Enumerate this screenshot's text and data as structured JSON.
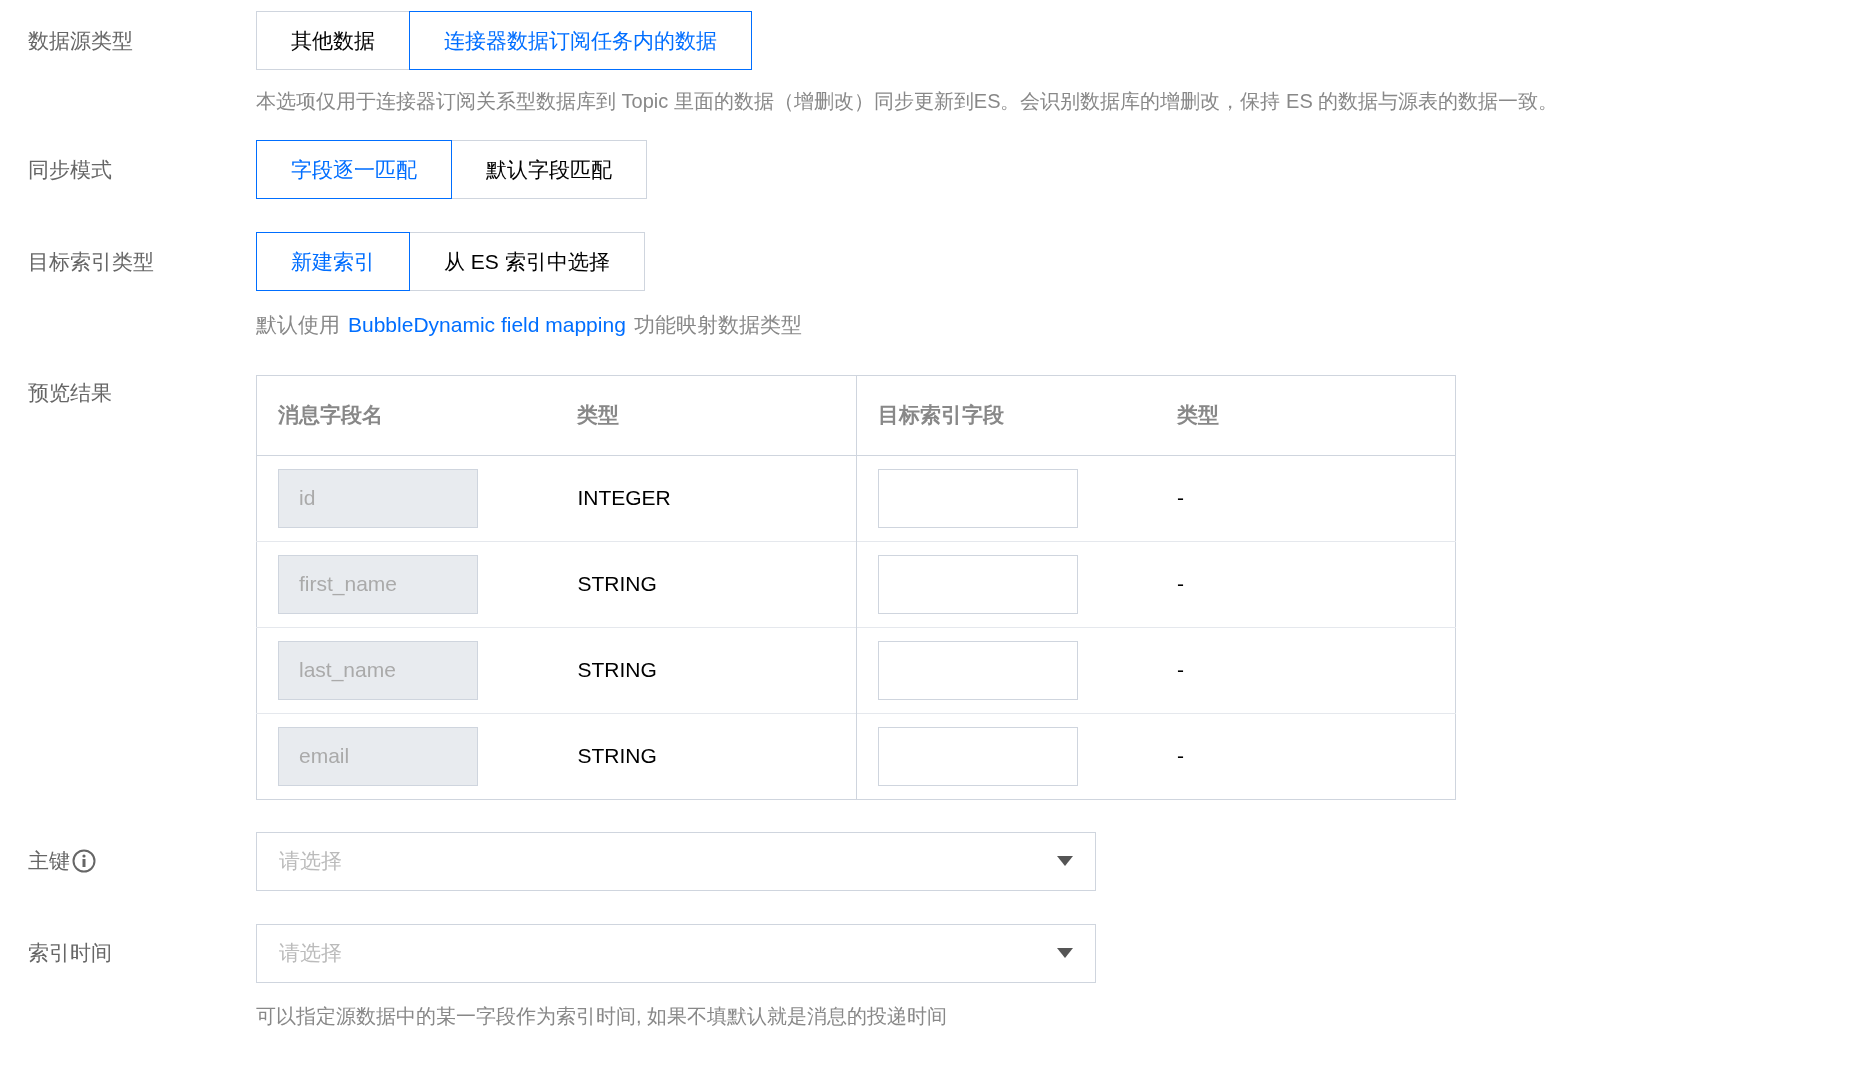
{
  "data_source_type": {
    "label": "数据源类型",
    "options": [
      {
        "label": "其他数据",
        "selected": false
      },
      {
        "label": "连接器数据订阅任务内的数据",
        "selected": true
      }
    ],
    "help": "本选项仅用于连接器订阅关系型数据库到 Topic 里面的数据（增删改）同步更新到ES。会识别数据库的增删改，保持 ES 的数据与源表的数据一致。"
  },
  "sync_mode": {
    "label": "同步模式",
    "options": [
      {
        "label": "字段逐一匹配",
        "selected": true
      },
      {
        "label": "默认字段匹配",
        "selected": false
      }
    ]
  },
  "target_index_type": {
    "label": "目标索引类型",
    "options": [
      {
        "label": "新建索引",
        "selected": true
      },
      {
        "label": "从 ES 索引中选择",
        "selected": false
      }
    ],
    "help_prefix": "默认使用",
    "help_link": "BubbleDynamic field mapping",
    "help_suffix": "功能映射数据类型"
  },
  "preview": {
    "label": "预览结果",
    "columns": [
      "消息字段名",
      "类型",
      "目标索引字段",
      "类型"
    ],
    "rows": [
      {
        "field": "id",
        "type": "INTEGER",
        "target_type": "-"
      },
      {
        "field": "first_name",
        "type": "STRING",
        "target_type": "-"
      },
      {
        "field": "last_name",
        "type": "STRING",
        "target_type": "-"
      },
      {
        "field": "email",
        "type": "STRING",
        "target_type": "-"
      }
    ]
  },
  "primary_key": {
    "label": "主键",
    "placeholder": "请选择"
  },
  "index_time": {
    "label": "索引时间",
    "placeholder": "请选择",
    "help": "可以指定源数据中的某一字段作为索引时间, 如果不填默认就是消息的投递时间"
  }
}
